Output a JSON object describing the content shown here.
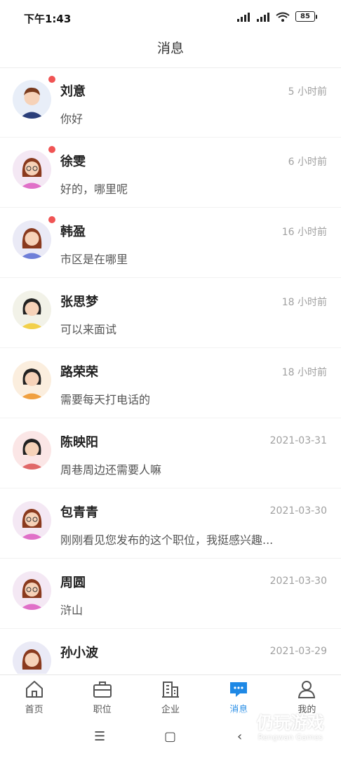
{
  "status_bar": {
    "time": "下午1:43",
    "battery": "85"
  },
  "header": {
    "title": "消息"
  },
  "messages": [
    {
      "name": "刘意",
      "time": "5 小时前",
      "preview": "你好",
      "unread": true
    },
    {
      "name": "徐雯",
      "time": "6 小时前",
      "preview": "好的，哪里呢",
      "unread": true
    },
    {
      "name": "韩盈",
      "time": "16 小时前",
      "preview": "市区是在哪里",
      "unread": true
    },
    {
      "name": "张思梦",
      "time": "18 小时前",
      "preview": "可以来面试",
      "unread": false
    },
    {
      "name": "路荣荣",
      "time": "18 小时前",
      "preview": "需要每天打电话的",
      "unread": false
    },
    {
      "name": "陈映阳",
      "time": "2021-03-31",
      "preview": "周巷周边还需要人嘛",
      "unread": false
    },
    {
      "name": "包青青",
      "time": "2021-03-30",
      "preview": "刚刚看见您发布的这个职位，我挺感兴趣...",
      "unread": false
    },
    {
      "name": "周圆",
      "time": "2021-03-30",
      "preview": "浒山",
      "unread": false
    },
    {
      "name": "孙小波",
      "time": "2021-03-29",
      "preview": "",
      "unread": false
    }
  ],
  "tabbar": {
    "items": [
      {
        "label": "首页",
        "icon": "home-icon"
      },
      {
        "label": "职位",
        "icon": "briefcase-icon"
      },
      {
        "label": "企业",
        "icon": "building-icon"
      },
      {
        "label": "消息",
        "icon": "chat-icon",
        "active": true
      },
      {
        "label": "我的",
        "icon": "user-icon"
      }
    ]
  },
  "watermark": {
    "text": "仍玩游戏",
    "sub": "Rengwan Games"
  },
  "colors": {
    "accent": "#1e88e5",
    "unread_dot": "#f05454"
  }
}
